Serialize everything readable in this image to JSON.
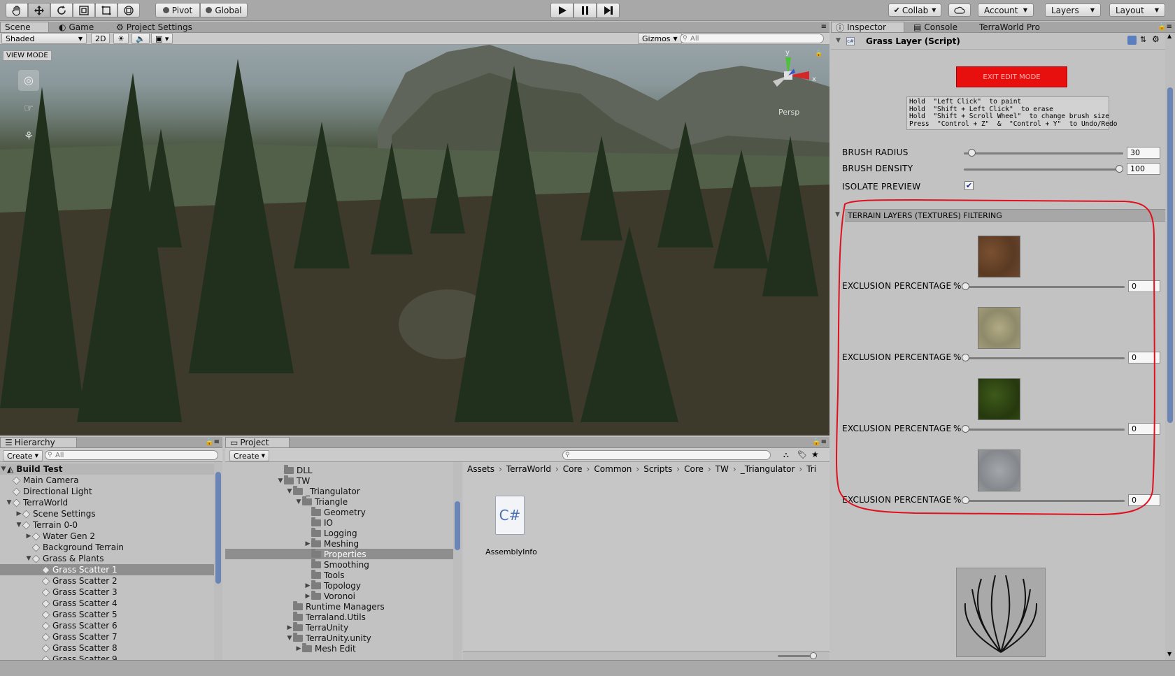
{
  "toolbar": {
    "tools": [
      "hand-tool-icon",
      "move-tool-icon",
      "rotate-tool-icon",
      "scale-tool-icon",
      "rect-tool-icon",
      "transform-tool-icon"
    ],
    "pivot": "Pivot",
    "global": "Global",
    "play_icons": [
      "play-icon",
      "pause-icon",
      "step-icon"
    ],
    "collab": "Collab",
    "account": "Account",
    "layers": "Layers",
    "layout": "Layout"
  },
  "scene_tabs": {
    "scene": "Scene",
    "game": "Game",
    "project_settings": "Project Settings"
  },
  "scene_toolbar": {
    "shading": "Shaded",
    "mode_2d": "2D",
    "gizmos": "Gizmos",
    "search_placeholder": "All"
  },
  "scene_view": {
    "view_mode": "VIEW MODE",
    "persp": "Persp",
    "axis_y": "y",
    "axis_x": "x"
  },
  "hierarchy": {
    "tab": "Hierarchy",
    "create": "Create",
    "search_placeholder": "All",
    "scene_name": "Build Test",
    "items": [
      {
        "label": "Main Camera",
        "indent": 1,
        "arrow": ""
      },
      {
        "label": "Directional Light",
        "indent": 1,
        "arrow": ""
      },
      {
        "label": "TerraWorld",
        "indent": 1,
        "arrow": "down"
      },
      {
        "label": "Scene Settings",
        "indent": 2,
        "arrow": "right"
      },
      {
        "label": "Terrain 0-0",
        "indent": 2,
        "arrow": "down"
      },
      {
        "label": "Water Gen 2",
        "indent": 3,
        "arrow": "right"
      },
      {
        "label": "Background Terrain",
        "indent": 3,
        "arrow": ""
      },
      {
        "label": "Grass & Plants",
        "indent": 3,
        "arrow": "down"
      },
      {
        "label": "Grass Scatter 1",
        "indent": 4,
        "arrow": "",
        "selected": true
      },
      {
        "label": "Grass Scatter 2",
        "indent": 4,
        "arrow": ""
      },
      {
        "label": "Grass Scatter 3",
        "indent": 4,
        "arrow": ""
      },
      {
        "label": "Grass Scatter 4",
        "indent": 4,
        "arrow": ""
      },
      {
        "label": "Grass Scatter 5",
        "indent": 4,
        "arrow": ""
      },
      {
        "label": "Grass Scatter 6",
        "indent": 4,
        "arrow": ""
      },
      {
        "label": "Grass Scatter 7",
        "indent": 4,
        "arrow": ""
      },
      {
        "label": "Grass Scatter 8",
        "indent": 4,
        "arrow": ""
      },
      {
        "label": "Grass Scatter 9",
        "indent": 4,
        "arrow": ""
      }
    ]
  },
  "project": {
    "tab": "Project",
    "create": "Create",
    "tree": [
      {
        "label": "DLL",
        "indent": 6,
        "arrow": ""
      },
      {
        "label": "TW",
        "indent": 6,
        "arrow": "down"
      },
      {
        "label": "_Triangulator",
        "indent": 7,
        "arrow": "down"
      },
      {
        "label": "Triangle",
        "indent": 8,
        "arrow": "down"
      },
      {
        "label": "Geometry",
        "indent": 9,
        "arrow": ""
      },
      {
        "label": "IO",
        "indent": 9,
        "arrow": ""
      },
      {
        "label": "Logging",
        "indent": 9,
        "arrow": ""
      },
      {
        "label": "Meshing",
        "indent": 9,
        "arrow": "right"
      },
      {
        "label": "Properties",
        "indent": 9,
        "arrow": "",
        "selected": true
      },
      {
        "label": "Smoothing",
        "indent": 9,
        "arrow": ""
      },
      {
        "label": "Tools",
        "indent": 9,
        "arrow": ""
      },
      {
        "label": "Topology",
        "indent": 9,
        "arrow": "right"
      },
      {
        "label": "Voronoi",
        "indent": 9,
        "arrow": "right"
      },
      {
        "label": "Runtime Managers",
        "indent": 7,
        "arrow": ""
      },
      {
        "label": "Terraland.Utils",
        "indent": 7,
        "arrow": ""
      },
      {
        "label": "TerraUnity",
        "indent": 7,
        "arrow": "right"
      },
      {
        "label": "TerraUnity.unity",
        "indent": 7,
        "arrow": "down"
      },
      {
        "label": "Mesh Edit",
        "indent": 8,
        "arrow": "right"
      }
    ],
    "breadcrumb": [
      "Assets",
      "TerraWorld",
      "Core",
      "Common",
      "Scripts",
      "Core",
      "TW",
      "_Triangulator",
      "Tri"
    ],
    "asset_name": "AssemblyInfo",
    "asset_icon_text": "C#"
  },
  "inspector": {
    "tabs": {
      "inspector": "Inspector",
      "console": "Console",
      "terraworld": "TerraWorld Pro"
    },
    "component_title": "Grass Layer (Script)",
    "exit_button": "EXIT EDIT MODE",
    "help_lines": [
      "Hold  \"Left Click\"  to paint",
      "Hold  \"Shift + Left Click\"  to erase",
      "Hold  \"Shift + Scroll Wheel\"  to change brush size",
      "Press  \"Control + Z\"  &  \"Control + Y\"  to Undo/Redo"
    ],
    "brush_radius_label": "BRUSH RADIUS",
    "brush_radius_value": "30",
    "brush_radius_fraction": 0.05,
    "brush_density_label": "BRUSH DENSITY",
    "brush_density_value": "100",
    "brush_density_fraction": 1.0,
    "isolate_label": "ISOLATE PREVIEW",
    "isolate_checked": true,
    "filter_header": "TERRAIN LAYERS (TEXTURES) FILTERING",
    "layers": [
      {
        "label": "EXCLUSION PERCENTAGE",
        "unit": "%",
        "value": "0",
        "fraction": 0,
        "texture": "dirt-texture"
      },
      {
        "label": "EXCLUSION PERCENTAGE",
        "unit": "%",
        "value": "0",
        "fraction": 0,
        "texture": "gravel-texture"
      },
      {
        "label": "EXCLUSION PERCENTAGE",
        "unit": "%",
        "value": "0",
        "fraction": 0,
        "texture": "grass-texture"
      },
      {
        "label": "EXCLUSION PERCENTAGE",
        "unit": "%",
        "value": "0",
        "fraction": 0,
        "texture": "rock-texture"
      }
    ],
    "highlight_color": "#e0101e",
    "exit_color": "#e8100f"
  }
}
